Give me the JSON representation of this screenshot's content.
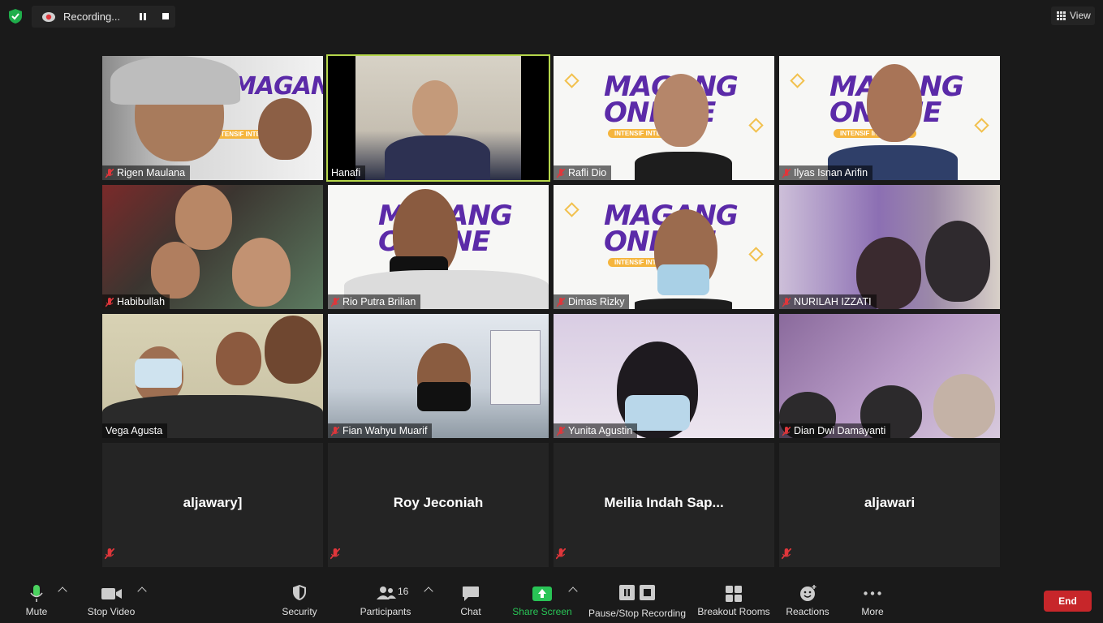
{
  "recording": {
    "label": "Recording..."
  },
  "view": {
    "label": "View"
  },
  "magang": {
    "line1": "MAGANG",
    "line2": "ONLINE",
    "pill": "INTENSIF INTERAKTIF"
  },
  "tiles": [
    {
      "name": "Rigen Maulana",
      "muted": true
    },
    {
      "name": "Hanafi",
      "muted": false,
      "active": true
    },
    {
      "name": "Rafli Dio",
      "muted": true
    },
    {
      "name": "Ilyas Isnan Arifin",
      "muted": true
    },
    {
      "name": "Habibullah",
      "muted": true
    },
    {
      "name": "Rio Putra Brilian",
      "muted": true
    },
    {
      "name": "Dimas Rizky",
      "muted": true
    },
    {
      "name": "NURILAH IZZATI",
      "muted": true
    },
    {
      "name": "Vega Agusta",
      "muted": false
    },
    {
      "name": "Fian Wahyu Muarif",
      "muted": true
    },
    {
      "name": "Yunita Agustin",
      "muted": true
    },
    {
      "name": "Dian Dwi Damayanti",
      "muted": true
    }
  ],
  "blank_tiles": [
    {
      "name": "aljawary]"
    },
    {
      "name": "Roy Jeconiah"
    },
    {
      "name": "Meilia Indah Sap..."
    },
    {
      "name": "aljawari"
    }
  ],
  "toolbar": {
    "mute": "Mute",
    "stop_video": "Stop Video",
    "security": "Security",
    "participants": "Participants",
    "participants_count": "16",
    "chat": "Chat",
    "share_screen": "Share Screen",
    "pause_stop_recording": "Pause/Stop Recording",
    "breakout_rooms": "Breakout Rooms",
    "reactions": "Reactions",
    "more": "More",
    "end": "End"
  },
  "colors": {
    "share_green": "#29c456",
    "end_red": "#c7262a",
    "active_border": "#b5d64b",
    "brand_purple": "#5b2aa8"
  }
}
